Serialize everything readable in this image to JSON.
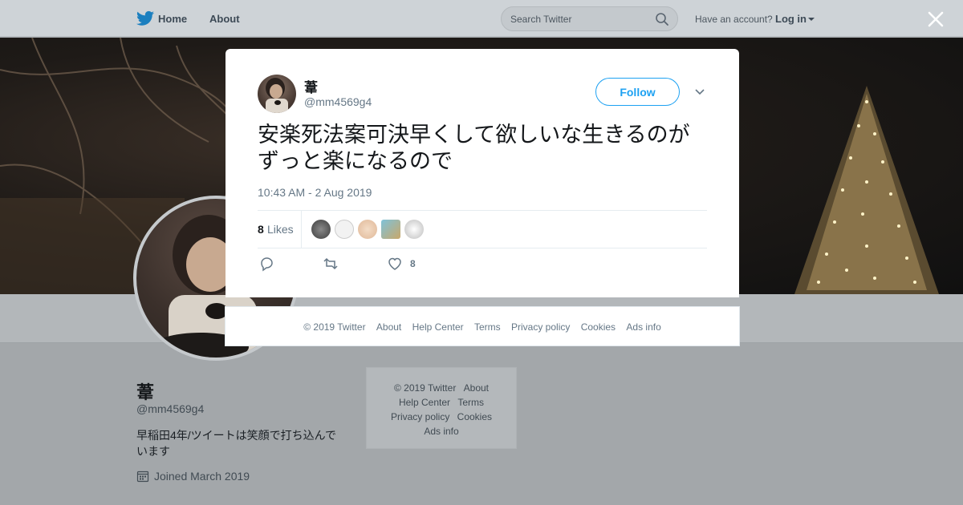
{
  "nav": {
    "home_label": "Home",
    "about_label": "About",
    "search_placeholder": "Search Twitter",
    "have_account": "Have an account?",
    "login_label": "Log in"
  },
  "tweet": {
    "display_name": "葦",
    "handle": "@mm4569g4",
    "follow_label": "Follow",
    "text_line1": "安楽死法案可決早くして欲しいな生きるのが",
    "text_line2": "ずっと楽になるので",
    "timestamp": "10:43 AM - 2 Aug 2019",
    "likes_count": "8",
    "likes_label": "Likes",
    "action_like_count": "8"
  },
  "modal_footer": {
    "copyright": "© 2019 Twitter",
    "about": "About",
    "help": "Help Center",
    "terms": "Terms",
    "privacy": "Privacy policy",
    "cookies": "Cookies",
    "ads": "Ads info"
  },
  "profile": {
    "name": "葦",
    "handle": "@mm4569g4",
    "bio": "早稲田4年/ツイートは笑顔で打ち込んでいます",
    "joined": "Joined March 2019"
  },
  "side_footer": {
    "copyright": "© 2019 Twitter",
    "about": "About",
    "help": "Help Center",
    "terms": "Terms",
    "privacy": "Privacy policy",
    "cookies": "Cookies",
    "ads": "Ads info"
  },
  "colors": {
    "accent": "#1da1f2",
    "overlay_gray": "#a3a7aa",
    "secondary_text": "#657786"
  },
  "icons": [
    "twitter-bird-icon",
    "search-icon",
    "caret-down-icon",
    "close-icon",
    "chevron-down-icon",
    "reply-icon",
    "retweet-icon",
    "heart-icon",
    "calendar-icon"
  ]
}
